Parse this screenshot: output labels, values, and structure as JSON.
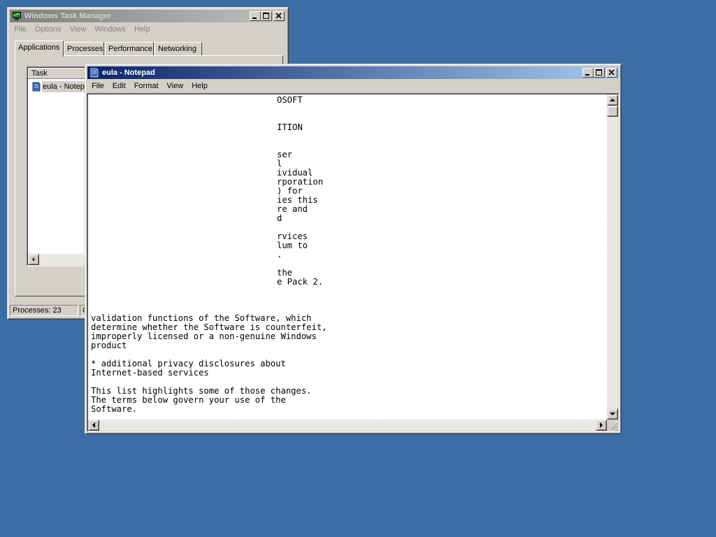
{
  "desktop": {
    "background": "#3a6ea5"
  },
  "task_manager": {
    "title": "Windows Task Manager",
    "menu": [
      "File",
      "Options",
      "View",
      "Windows",
      "Help"
    ],
    "tabs": [
      "Applications",
      "Processes",
      "Performance",
      "Networking"
    ],
    "selected_tab": "Applications",
    "task_column": "Task",
    "tasks": [
      "eula - Notepad"
    ],
    "status_processes": "Processes: 23",
    "status_cpu": "C"
  },
  "notepad": {
    "title": "eula - Notepad",
    "menu": [
      "File",
      "Edit",
      "Format",
      "View",
      "Help"
    ],
    "visible_text_fragments": [
      "OSOFT",
      "ITION",
      "ser",
      "l",
      "ividual",
      "rporation",
      ") for",
      "ies this",
      "re and",
      "d",
      "rvices",
      "lum to",
      ".",
      "the",
      "e Pack 2."
    ],
    "text_lines": [
      "validation functions of the Software, which",
      "determine whether the Software is counterfeit,",
      "improperly licensed or a non-genuine Windows",
      "product",
      "",
      "* additional privacy disclosures about",
      "Internet-based services",
      "",
      "This list highlights some of those changes.",
      "The terms below govern your use of the",
      "Software."
    ]
  }
}
